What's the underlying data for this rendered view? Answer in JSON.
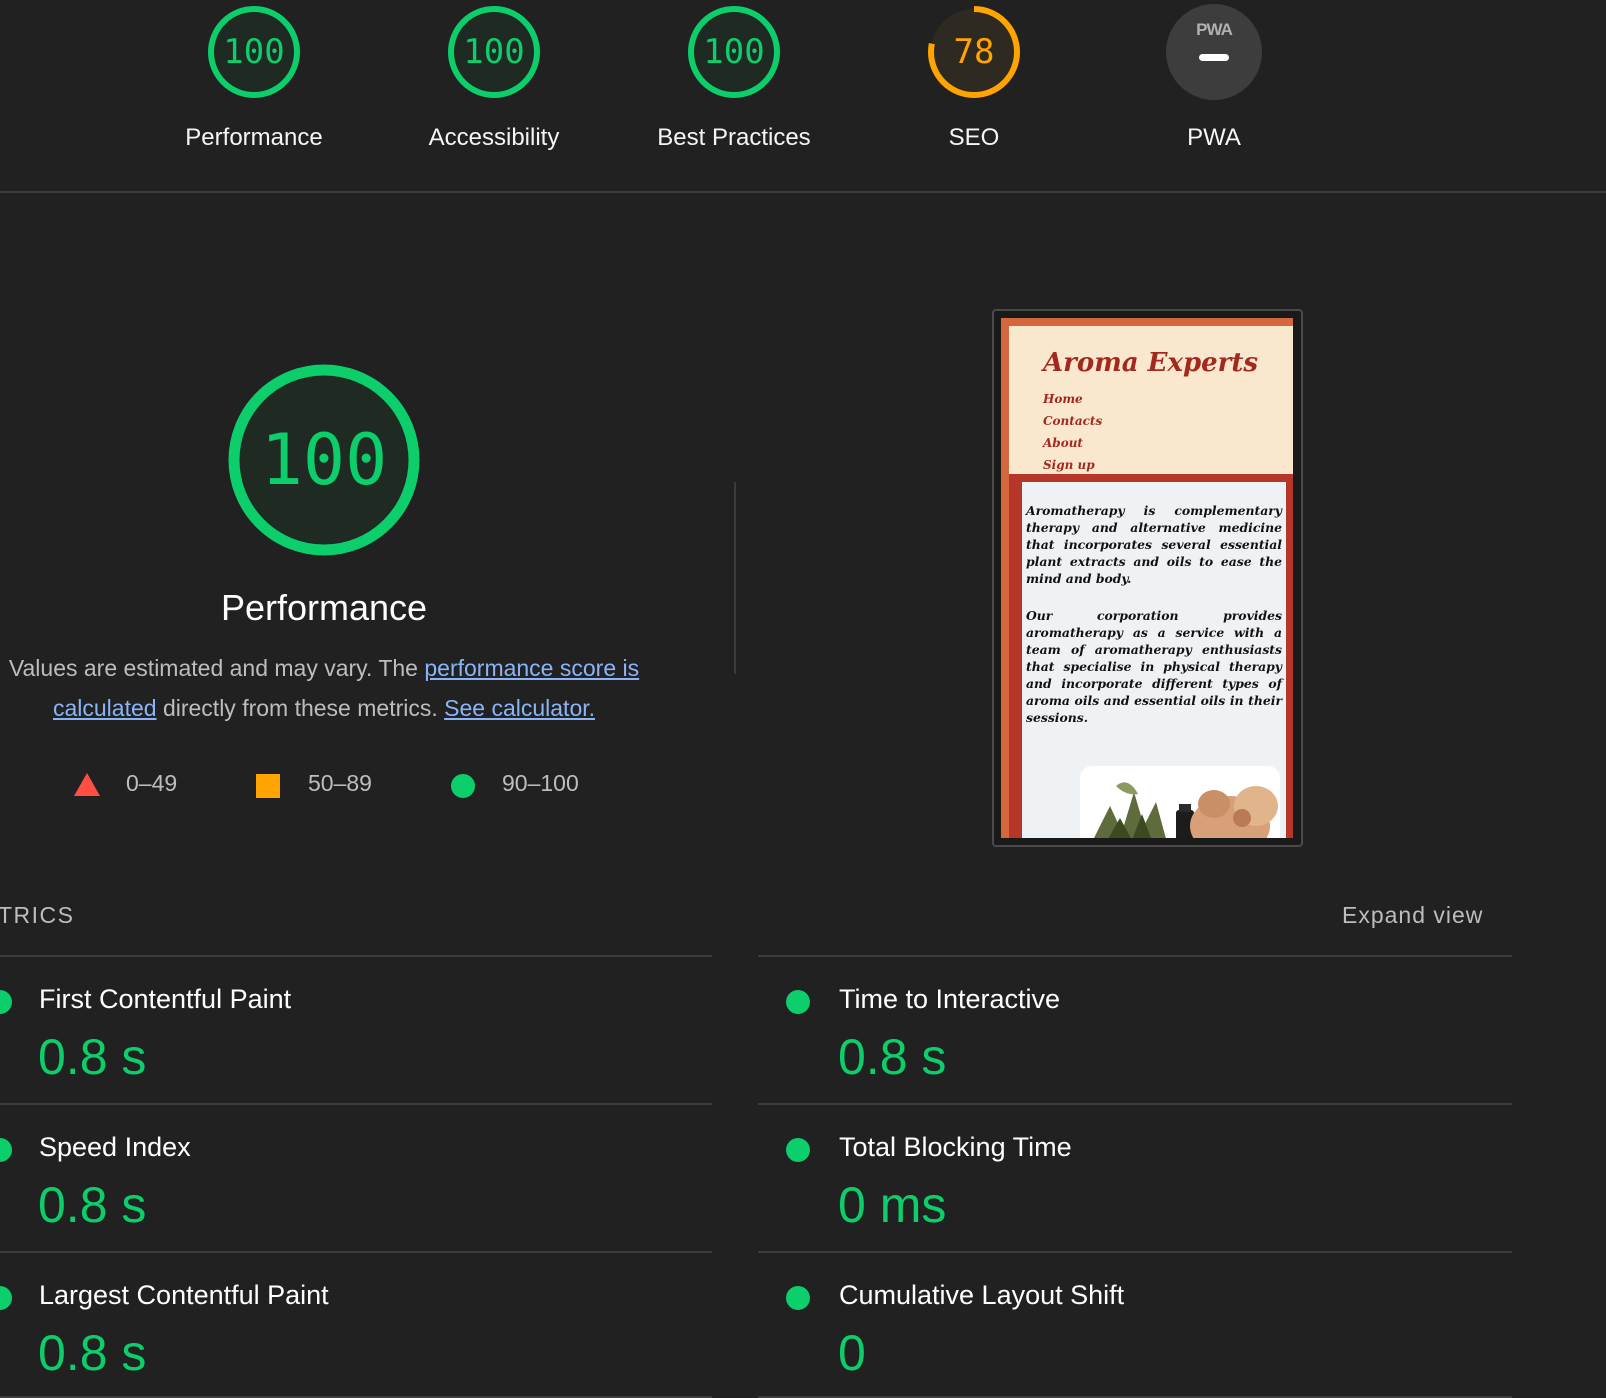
{
  "gauges": [
    {
      "score": "100",
      "label": "Performance",
      "rating": "pass"
    },
    {
      "score": "100",
      "label": "Accessibility",
      "rating": "pass"
    },
    {
      "score": "100",
      "label": "Best Practices",
      "rating": "pass"
    },
    {
      "score": "78",
      "label": "SEO",
      "rating": "average",
      "fraction": 0.78
    },
    {
      "score": "PWA",
      "label": "PWA",
      "rating": "not-applicable"
    }
  ],
  "colors": {
    "pass": "#0cce6b",
    "average": "#ffa400",
    "fail": "#ff4e42",
    "background": "#212121",
    "link": "#8ab4f8"
  },
  "performance": {
    "score": "100",
    "title": "Performance",
    "desc_start": "Values are estimated and may vary. The ",
    "link1": "performance score is calculated",
    "desc_mid": " directly from these metrics. ",
    "link2": "See calculator.",
    "scale": [
      {
        "shape": "triangle",
        "label": "0–49"
      },
      {
        "shape": "square",
        "label": "50–89"
      },
      {
        "shape": "circle",
        "label": "90–100"
      }
    ]
  },
  "screenshot": {
    "site_title": "Aroma Experts",
    "nav": [
      "Home",
      "Contacts",
      "About",
      "Sign up"
    ],
    "para1": "Aromatherapy is complementary therapy and alternative medicine that incorporates several essential plant extracts and oils to ease the mind and body.",
    "para2": "Our corporation provides aromatherapy as a service with a team of aromatherapy enthusiasts that specialise in physical therapy and incorporate different types of aroma oils and essential oils in their sessions."
  },
  "metrics": {
    "heading": "TRICS",
    "expand_label": "Expand view",
    "items": [
      {
        "title": "First Contentful Paint",
        "value": "0.8 s"
      },
      {
        "title": "Time to Interactive",
        "value": "0.8 s"
      },
      {
        "title": "Speed Index",
        "value": "0.8 s"
      },
      {
        "title": "Total Blocking Time",
        "value": "0 ms"
      },
      {
        "title": "Largest Contentful Paint",
        "value": "0.8 s"
      },
      {
        "title": "Cumulative Layout Shift",
        "value": "0"
      }
    ]
  }
}
